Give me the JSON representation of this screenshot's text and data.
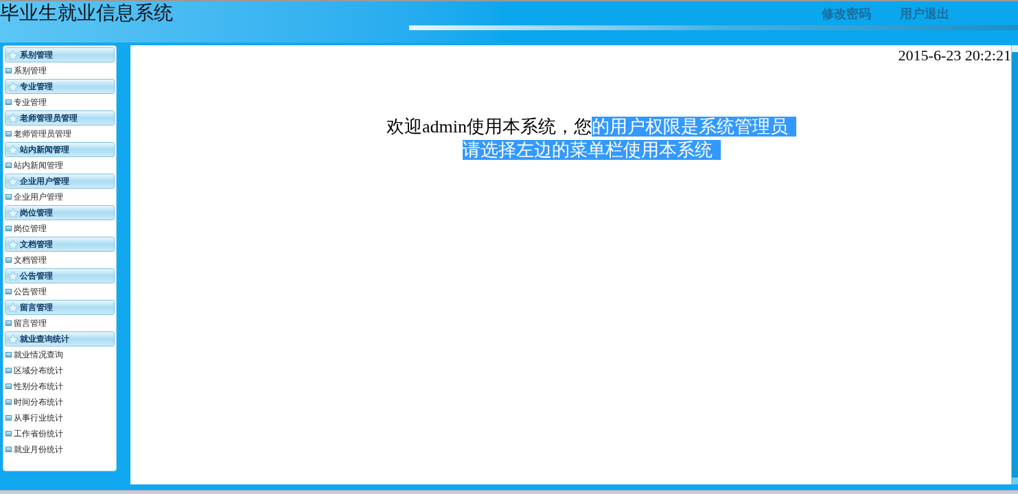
{
  "header": {
    "title": "毕业生就业信息系统",
    "links": [
      "修改密码",
      "用户退出"
    ]
  },
  "sidebar": {
    "groups": [
      {
        "title": "系别管理",
        "items": [
          "系别管理"
        ]
      },
      {
        "title": "专业管理",
        "items": [
          "专业管理"
        ]
      },
      {
        "title": "老师管理员管理",
        "items": [
          "老师管理员管理"
        ]
      },
      {
        "title": "站内新闻管理",
        "items": [
          "站内新闻管理"
        ]
      },
      {
        "title": "企业用户管理",
        "items": [
          "企业用户管理"
        ]
      },
      {
        "title": "岗位管理",
        "items": [
          "岗位管理"
        ]
      },
      {
        "title": "文档管理",
        "items": [
          "文档管理"
        ]
      },
      {
        "title": "公告管理",
        "items": [
          "公告管理"
        ]
      },
      {
        "title": "留言管理",
        "items": [
          "留言管理"
        ]
      },
      {
        "title": "就业查询统计",
        "items": [
          "就业情况查询",
          "区域分布统计",
          "性别分布统计",
          "时间分布统计",
          "从事行业统计",
          "工作省份统计",
          "就业月份统计"
        ]
      }
    ]
  },
  "main": {
    "datetime": "2015-6-23 20:2:21",
    "welcome": [
      [
        {
          "text": "欢迎admin使用本系统，您",
          "selected": false
        },
        {
          "text": "的用户权限是系统管理员",
          "selected": true
        }
      ],
      [
        {
          "text": "请选择左边的菜单栏使用本系统",
          "selected": true
        }
      ]
    ]
  }
}
